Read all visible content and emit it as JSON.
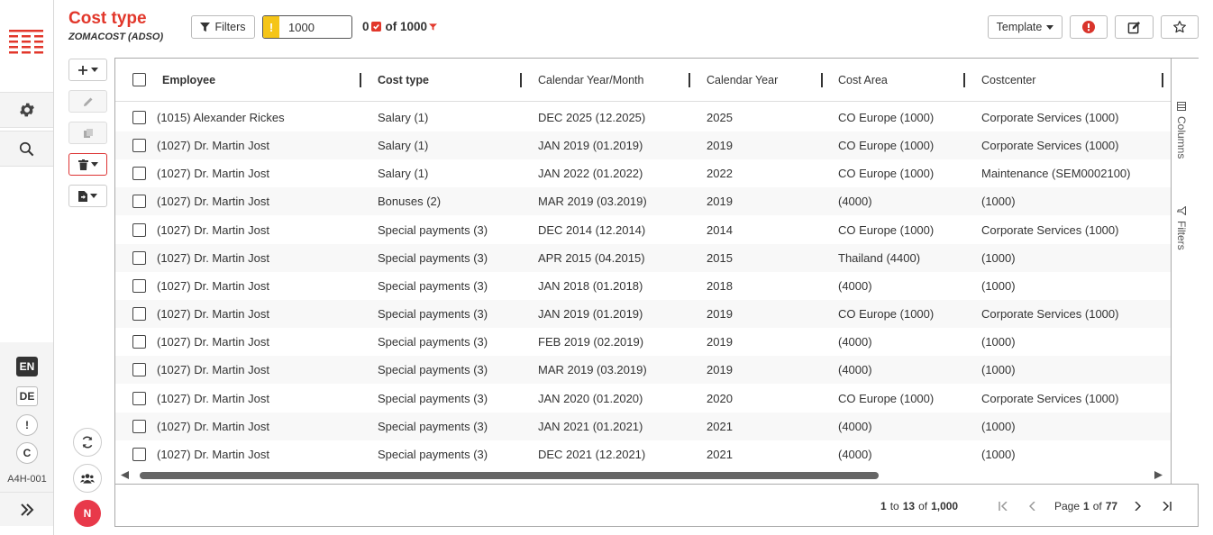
{
  "app": {
    "title": "Cost type",
    "subtitle": "ZOMACOST (ADSO)"
  },
  "toolbar": {
    "filters_label": "Filters",
    "limit_warning": "!",
    "limit_value": "1000",
    "count_prefix": "0",
    "count_text": "of 1000",
    "template_label": "Template"
  },
  "sidebar": {
    "languages": [
      "EN",
      "DE"
    ],
    "warning_label": "!",
    "c_label": "C",
    "system_id": "A4H-001"
  },
  "user": {
    "initial": "N"
  },
  "colors": {
    "accent": "#e2372b",
    "warning": "#f5c518",
    "avatar": "#e8394a"
  },
  "grid": {
    "columns": [
      "Employee",
      "Cost type",
      "Calendar Year/Month",
      "Calendar Year",
      "Cost Area",
      "Costcenter"
    ],
    "rows": [
      [
        "(1015) Alexander Rickes",
        "Salary (1)",
        "DEC 2025 (12.2025)",
        "2025",
        "CO Europe (1000)",
        "Corporate Services (1000)"
      ],
      [
        "(1027) Dr. Martin Jost",
        "Salary (1)",
        "JAN 2019 (01.2019)",
        "2019",
        "CO Europe (1000)",
        "Corporate Services (1000)"
      ],
      [
        "(1027) Dr. Martin Jost",
        "Salary (1)",
        "JAN 2022 (01.2022)",
        "2022",
        "CO Europe (1000)",
        "Maintenance (SEM0002100)"
      ],
      [
        "(1027) Dr. Martin Jost",
        "Bonuses (2)",
        "MAR 2019 (03.2019)",
        "2019",
        "(4000)",
        "(1000)"
      ],
      [
        "(1027) Dr. Martin Jost",
        "Special payments (3)",
        "DEC 2014 (12.2014)",
        "2014",
        "CO Europe (1000)",
        "Corporate Services (1000)"
      ],
      [
        "(1027) Dr. Martin Jost",
        "Special payments (3)",
        "APR 2015 (04.2015)",
        "2015",
        "Thailand (4400)",
        "(1000)"
      ],
      [
        "(1027) Dr. Martin Jost",
        "Special payments (3)",
        "JAN 2018 (01.2018)",
        "2018",
        "(4000)",
        "(1000)"
      ],
      [
        "(1027) Dr. Martin Jost",
        "Special payments (3)",
        "JAN 2019 (01.2019)",
        "2019",
        "CO Europe (1000)",
        "Corporate Services (1000)"
      ],
      [
        "(1027) Dr. Martin Jost",
        "Special payments (3)",
        "FEB 2019 (02.2019)",
        "2019",
        "(4000)",
        "(1000)"
      ],
      [
        "(1027) Dr. Martin Jost",
        "Special payments (3)",
        "MAR 2019 (03.2019)",
        "2019",
        "(4000)",
        "(1000)"
      ],
      [
        "(1027) Dr. Martin Jost",
        "Special payments (3)",
        "JAN 2020 (01.2020)",
        "2020",
        "CO Europe (1000)",
        "Corporate Services (1000)"
      ],
      [
        "(1027) Dr. Martin Jost",
        "Special payments (3)",
        "JAN 2021 (01.2021)",
        "2021",
        "(4000)",
        "(1000)"
      ],
      [
        "(1027) Dr. Martin Jost",
        "Special payments (3)",
        "DEC 2021 (12.2021)",
        "2021",
        "(4000)",
        "(1000)"
      ]
    ],
    "side_tabs": {
      "columns": "Columns",
      "filters": "Filters"
    }
  },
  "pager": {
    "range_start": "1",
    "range_to": "to",
    "range_end": "13",
    "of_label": "of",
    "total": "1,000",
    "page_label": "Page",
    "current_page": "1",
    "page_of": "of",
    "total_pages": "77"
  }
}
